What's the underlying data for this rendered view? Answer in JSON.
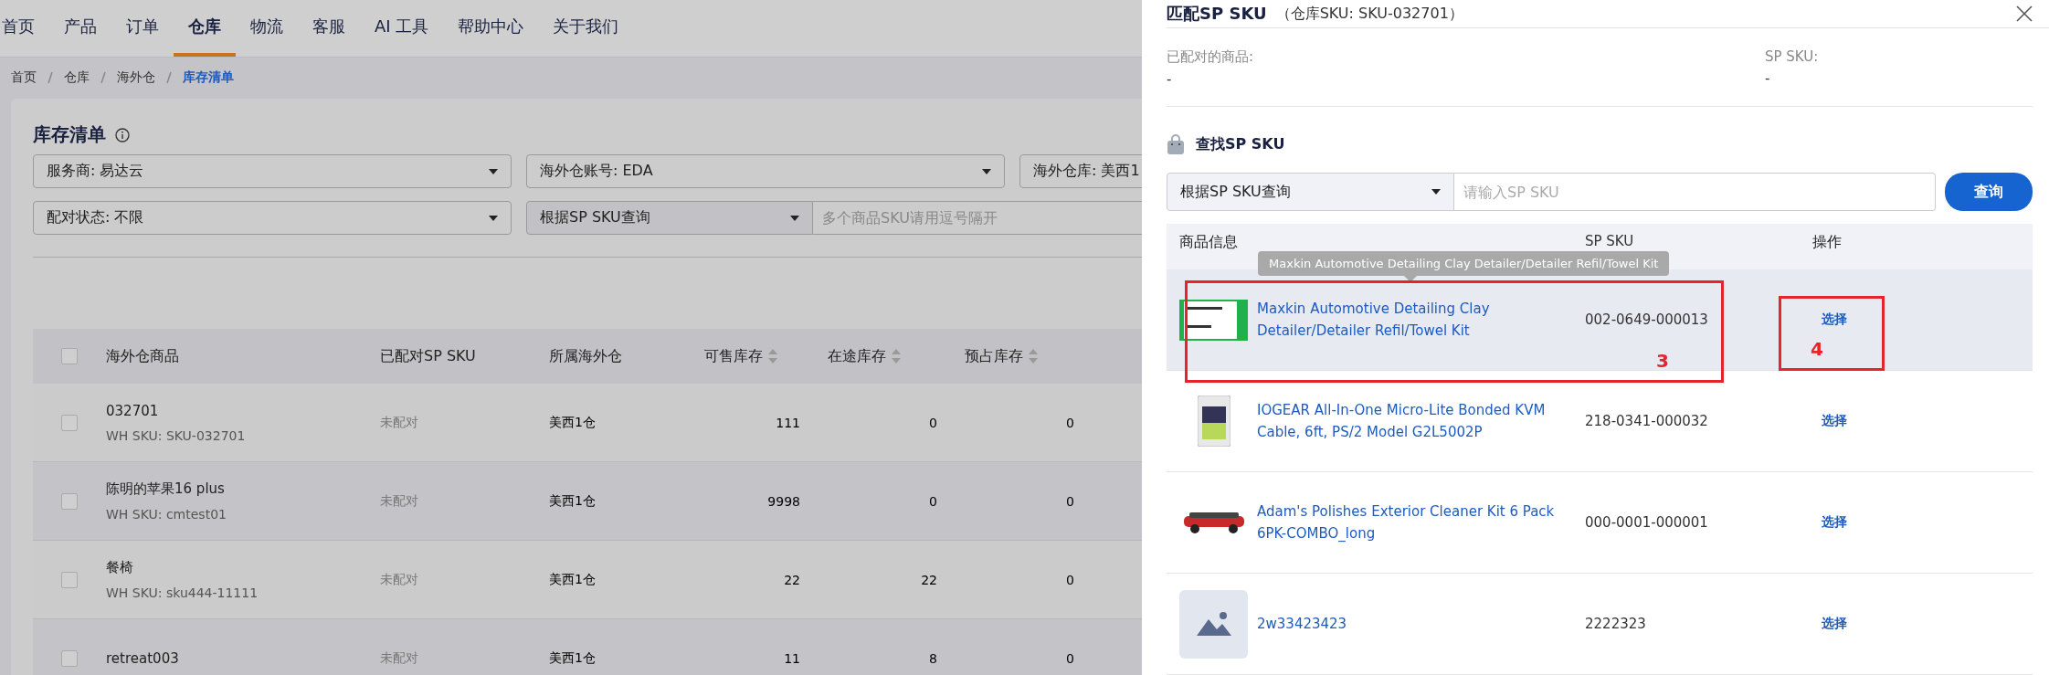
{
  "nav": [
    {
      "label": "首页",
      "selected": false
    },
    {
      "label": "产品",
      "selected": false
    },
    {
      "label": "订单",
      "selected": false
    },
    {
      "label": "仓库",
      "selected": true
    },
    {
      "label": "物流",
      "selected": false
    },
    {
      "label": "客服",
      "selected": false
    },
    {
      "label": "AI 工具",
      "selected": false
    },
    {
      "label": "帮助中心",
      "selected": false
    },
    {
      "label": "关于我们",
      "selected": false
    }
  ],
  "breadcrumb": [
    "首页",
    "仓库",
    "海外仓",
    "库存清单"
  ],
  "page_title": "库存清单",
  "filters": [
    {
      "kind": "select",
      "value": "服务商: 易达云"
    },
    {
      "kind": "select",
      "value": "海外仓账号: EDA"
    },
    {
      "kind": "select",
      "value": "海外仓库: 美西1"
    },
    {
      "kind": "select",
      "value": "配对状态: 不限"
    },
    {
      "kind": "search",
      "value": "根据SP SKU查询",
      "placeholder": "多个商品SKU请用逗号隔开"
    }
  ],
  "table": {
    "columns": [
      {
        "label": "海外仓商品",
        "sortable": false
      },
      {
        "label": "已配对SP SKU",
        "sortable": false
      },
      {
        "label": "所属海外仓",
        "sortable": false
      },
      {
        "label": "可售库存",
        "sortable": true
      },
      {
        "label": "在途库存",
        "sortable": true
      },
      {
        "label": "预占库存",
        "sortable": true
      }
    ],
    "select_all_checked": false,
    "rows": [
      {
        "name": "032701",
        "wh_sku": "WH SKU: SKU-032701",
        "paired": "未配对",
        "warehouse": "美西1仓",
        "available": "111",
        "in_transit": "0",
        "reserved": "0",
        "checked": false
      },
      {
        "name": "陈明的苹果16 plus",
        "wh_sku": "WH SKU: cmtest01",
        "paired": "未配对",
        "warehouse": "美西1仓",
        "available": "9998",
        "in_transit": "0",
        "reserved": "0",
        "checked": false
      },
      {
        "name": "餐椅",
        "wh_sku": "WH SKU: sku444-11111",
        "paired": "未配对",
        "warehouse": "美西1仓",
        "available": "22",
        "in_transit": "22",
        "reserved": "0",
        "checked": false
      },
      {
        "name": "retreat003",
        "paired": "未配对",
        "warehouse": "美西1仓",
        "available": "11",
        "in_transit": "8",
        "reserved": "0",
        "checked": false
      }
    ]
  },
  "drawer": {
    "title": "匹配SP SKU",
    "subtitle": "（仓库SKU: SKU-032701）",
    "paired_product": {
      "label": "已配对的商品:",
      "value": "-"
    },
    "paired_sku": {
      "label": "SP SKU:",
      "value": "-"
    },
    "section_title": "查找SP SKU",
    "search": {
      "mode": "根据SP SKU查询",
      "placeholder": "请输入SP SKU",
      "button": "查询"
    },
    "columns": [
      "商品信息",
      "SP SKU",
      "操作"
    ],
    "rows": [
      {
        "kind": "label",
        "name": "Maxkin Automotive Detailing Clay Detailer/Detailer Refil/Towel Kit",
        "sp_sku": "002-0649-000013",
        "action": "选择",
        "hovered": true,
        "tooltip": "Maxkin Automotive Detailing Clay Detailer/Detailer Refil/Towel Kit",
        "product_mark": "3",
        "action_mark": "4"
      },
      {
        "kind": "device",
        "name": "IOGEAR All-In-One Micro-Lite Bonded KVM Cable, 6ft, PS/2 Model G2L5002P",
        "sp_sku": "218-0341-000032",
        "action": "选择",
        "hovered": false
      },
      {
        "kind": "car",
        "name": "Adam's Polishes Exterior Cleaner Kit 6 Pack 6PK-COMBO_long",
        "sp_sku": "000-0001-000001",
        "action": "选择",
        "hovered": false
      },
      {
        "kind": "placeholder",
        "name": "2w33423423",
        "sp_sku": "2222323",
        "action": "选择",
        "hovered": false
      }
    ]
  }
}
